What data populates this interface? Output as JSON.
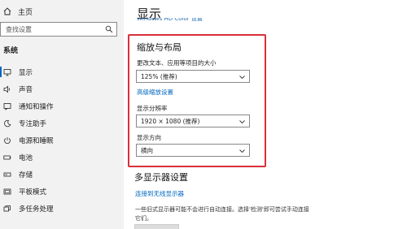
{
  "sidebar": {
    "home_label": "主页",
    "search_placeholder": "查找设置",
    "section_label": "系统",
    "items": [
      {
        "label": "显示",
        "icon": "monitor-icon"
      },
      {
        "label": "声音",
        "icon": "speaker-icon"
      },
      {
        "label": "通知和操作",
        "icon": "notification-icon"
      },
      {
        "label": "专注助手",
        "icon": "moon-icon"
      },
      {
        "label": "电源和睡眠",
        "icon": "power-icon"
      },
      {
        "label": "电池",
        "icon": "battery-icon"
      },
      {
        "label": "存储",
        "icon": "storage-icon"
      },
      {
        "label": "平板模式",
        "icon": "tablet-icon"
      },
      {
        "label": "多任务处理",
        "icon": "multitask-icon"
      }
    ]
  },
  "main": {
    "title": "显示",
    "color_link": "Windows HD Color 设置",
    "scale_section": {
      "heading": "缩放与布局",
      "text_size_label": "更改文本、应用等项目的大小",
      "text_size_value": "125% (推荐)",
      "advanced_scale_link": "高级缩放设置",
      "resolution_label": "显示分辨率",
      "resolution_value": "1920 × 1080 (推荐)",
      "orientation_label": "显示方向",
      "orientation_value": "横向"
    },
    "multi_display": {
      "heading": "多显示器设置",
      "wireless_link": "连接到无线显示器",
      "desc_line1": "一些旧式显示器可能不会进行自动连接。选择'检测'即可尝试手动连接",
      "desc_line2": "它们。"
    }
  },
  "colors": {
    "accent": "#0067c0",
    "highlight_border": "#d9303a",
    "sidebar_bg": "#f2f2f2"
  }
}
